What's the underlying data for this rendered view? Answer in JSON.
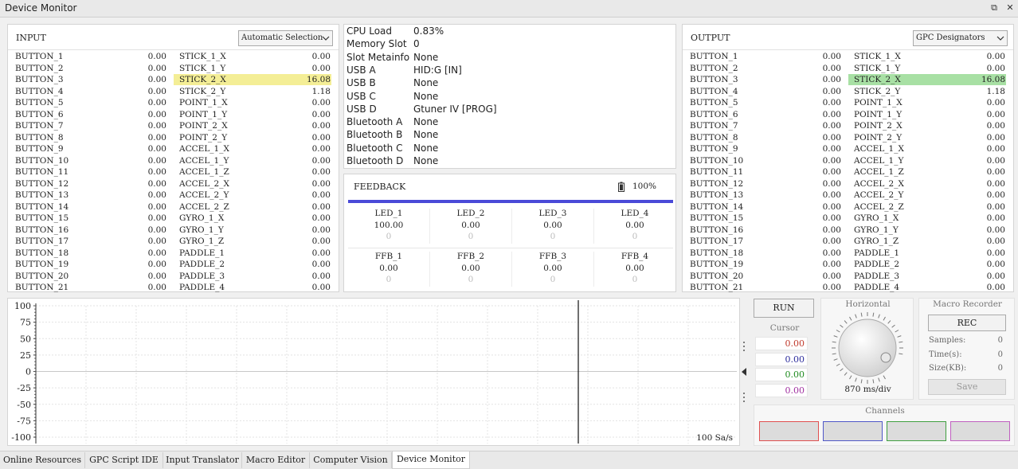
{
  "window": {
    "title": "Device Monitor"
  },
  "input": {
    "title": "INPUT",
    "selector": "Automatic Selection",
    "rows": [
      {
        "b": "BUTTON_1",
        "bv": "0.00",
        "a": "STICK_1_X",
        "av": "0.00"
      },
      {
        "b": "BUTTON_2",
        "bv": "0.00",
        "a": "STICK_1_Y",
        "av": "0.00"
      },
      {
        "b": "BUTTON_3",
        "bv": "0.00",
        "a": "STICK_2_X",
        "av": "16.08"
      },
      {
        "b": "BUTTON_4",
        "bv": "0.00",
        "a": "STICK_2_Y",
        "av": "1.18"
      },
      {
        "b": "BUTTON_5",
        "bv": "0.00",
        "a": "POINT_1_X",
        "av": "0.00"
      },
      {
        "b": "BUTTON_6",
        "bv": "0.00",
        "a": "POINT_1_Y",
        "av": "0.00"
      },
      {
        "b": "BUTTON_7",
        "bv": "0.00",
        "a": "POINT_2_X",
        "av": "0.00"
      },
      {
        "b": "BUTTON_8",
        "bv": "0.00",
        "a": "POINT_2_Y",
        "av": "0.00"
      },
      {
        "b": "BUTTON_9",
        "bv": "0.00",
        "a": "ACCEL_1_X",
        "av": "0.00"
      },
      {
        "b": "BUTTON_10",
        "bv": "0.00",
        "a": "ACCEL_1_Y",
        "av": "0.00"
      },
      {
        "b": "BUTTON_11",
        "bv": "0.00",
        "a": "ACCEL_1_Z",
        "av": "0.00"
      },
      {
        "b": "BUTTON_12",
        "bv": "0.00",
        "a": "ACCEL_2_X",
        "av": "0.00"
      },
      {
        "b": "BUTTON_13",
        "bv": "0.00",
        "a": "ACCEL_2_Y",
        "av": "0.00"
      },
      {
        "b": "BUTTON_14",
        "bv": "0.00",
        "a": "ACCEL_2_Z",
        "av": "0.00"
      },
      {
        "b": "BUTTON_15",
        "bv": "0.00",
        "a": "GYRO_1_X",
        "av": "0.00"
      },
      {
        "b": "BUTTON_16",
        "bv": "0.00",
        "a": "GYRO_1_Y",
        "av": "0.00"
      },
      {
        "b": "BUTTON_17",
        "bv": "0.00",
        "a": "GYRO_1_Z",
        "av": "0.00"
      },
      {
        "b": "BUTTON_18",
        "bv": "0.00",
        "a": "PADDLE_1",
        "av": "0.00"
      },
      {
        "b": "BUTTON_19",
        "bv": "0.00",
        "a": "PADDLE_2",
        "av": "0.00"
      },
      {
        "b": "BUTTON_20",
        "bv": "0.00",
        "a": "PADDLE_3",
        "av": "0.00"
      },
      {
        "b": "BUTTON_21",
        "bv": "0.00",
        "a": "PADDLE_4",
        "av": "0.00"
      }
    ],
    "highlight_row": 2,
    "highlight_color": "#f4ee96"
  },
  "output": {
    "title": "OUTPUT",
    "selector": "GPC Designators",
    "rows": [
      {
        "b": "BUTTON_1",
        "bv": "0.00",
        "a": "STICK_1_X",
        "av": "0.00"
      },
      {
        "b": "BUTTON_2",
        "bv": "0.00",
        "a": "STICK_1_Y",
        "av": "0.00"
      },
      {
        "b": "BUTTON_3",
        "bv": "0.00",
        "a": "STICK_2_X",
        "av": "16.08"
      },
      {
        "b": "BUTTON_4",
        "bv": "0.00",
        "a": "STICK_2_Y",
        "av": "1.18"
      },
      {
        "b": "BUTTON_5",
        "bv": "0.00",
        "a": "POINT_1_X",
        "av": "0.00"
      },
      {
        "b": "BUTTON_6",
        "bv": "0.00",
        "a": "POINT_1_Y",
        "av": "0.00"
      },
      {
        "b": "BUTTON_7",
        "bv": "0.00",
        "a": "POINT_2_X",
        "av": "0.00"
      },
      {
        "b": "BUTTON_8",
        "bv": "0.00",
        "a": "POINT_2_Y",
        "av": "0.00"
      },
      {
        "b": "BUTTON_9",
        "bv": "0.00",
        "a": "ACCEL_1_X",
        "av": "0.00"
      },
      {
        "b": "BUTTON_10",
        "bv": "0.00",
        "a": "ACCEL_1_Y",
        "av": "0.00"
      },
      {
        "b": "BUTTON_11",
        "bv": "0.00",
        "a": "ACCEL_1_Z",
        "av": "0.00"
      },
      {
        "b": "BUTTON_12",
        "bv": "0.00",
        "a": "ACCEL_2_X",
        "av": "0.00"
      },
      {
        "b": "BUTTON_13",
        "bv": "0.00",
        "a": "ACCEL_2_Y",
        "av": "0.00"
      },
      {
        "b": "BUTTON_14",
        "bv": "0.00",
        "a": "ACCEL_2_Z",
        "av": "0.00"
      },
      {
        "b": "BUTTON_15",
        "bv": "0.00",
        "a": "GYRO_1_X",
        "av": "0.00"
      },
      {
        "b": "BUTTON_16",
        "bv": "0.00",
        "a": "GYRO_1_Y",
        "av": "0.00"
      },
      {
        "b": "BUTTON_17",
        "bv": "0.00",
        "a": "GYRO_1_Z",
        "av": "0.00"
      },
      {
        "b": "BUTTON_18",
        "bv": "0.00",
        "a": "PADDLE_1",
        "av": "0.00"
      },
      {
        "b": "BUTTON_19",
        "bv": "0.00",
        "a": "PADDLE_2",
        "av": "0.00"
      },
      {
        "b": "BUTTON_20",
        "bv": "0.00",
        "a": "PADDLE_3",
        "av": "0.00"
      },
      {
        "b": "BUTTON_21",
        "bv": "0.00",
        "a": "PADDLE_4",
        "av": "0.00"
      }
    ],
    "highlight_row": 2,
    "highlight_color": "#a8e0a4"
  },
  "status": [
    {
      "k": "CPU Load",
      "v": "0.83%"
    },
    {
      "k": "Memory Slot",
      "v": "0"
    },
    {
      "k": "Slot Metainfo",
      "v": "None"
    },
    {
      "k": "USB A",
      "v": "HID:G [IN]"
    },
    {
      "k": "USB B",
      "v": "None"
    },
    {
      "k": "USB C",
      "v": "None"
    },
    {
      "k": "USB D",
      "v": "Gtuner IV [PROG]"
    },
    {
      "k": "Bluetooth A",
      "v": "None"
    },
    {
      "k": "Bluetooth B",
      "v": "None"
    },
    {
      "k": "Bluetooth C",
      "v": "None"
    },
    {
      "k": "Bluetooth D",
      "v": "None"
    }
  ],
  "feedback": {
    "title": "FEEDBACK",
    "battery": "100%",
    "bar_color": "#4a4ad8",
    "leds": [
      {
        "label": "LED_1",
        "value": "100.00",
        "raw": "0"
      },
      {
        "label": "LED_2",
        "value": "0.00",
        "raw": "0"
      },
      {
        "label": "LED_3",
        "value": "0.00",
        "raw": "0"
      },
      {
        "label": "LED_4",
        "value": "0.00",
        "raw": "0"
      }
    ],
    "ffb": [
      {
        "label": "FFB_1",
        "value": "0.00",
        "raw": "0"
      },
      {
        "label": "FFB_2",
        "value": "0.00",
        "raw": "0"
      },
      {
        "label": "FFB_3",
        "value": "0.00",
        "raw": "0"
      },
      {
        "label": "FFB_4",
        "value": "0.00",
        "raw": "0"
      }
    ]
  },
  "scope": {
    "y_ticks": [
      "100",
      "75",
      "50",
      "25",
      "0",
      "-25",
      "-50",
      "-75",
      "-100"
    ],
    "rate": "100 Sa/s"
  },
  "controls": {
    "run_label": "RUN",
    "cursor_label": "Cursor",
    "cursor_values": [
      {
        "v": "0.00",
        "color": "#c0392b"
      },
      {
        "v": "0.00",
        "color": "#2c2c9c"
      },
      {
        "v": "0.00",
        "color": "#1e8a1e"
      },
      {
        "v": "0.00",
        "color": "#a030a0"
      }
    ],
    "horizontal_label": "Horizontal",
    "horizontal_value": "870 ms/div",
    "macro": {
      "title": "Macro Recorder",
      "rec_label": "REC",
      "samples_label": "Samples:",
      "samples": "0",
      "time_label": "Time(s):",
      "time": "0",
      "size_label": "Size(KB):",
      "size": "0",
      "save_label": "Save"
    },
    "channels_label": "Channels",
    "channel_colors": [
      "#e05050",
      "#5058c8",
      "#40a040",
      "#c060c0"
    ]
  },
  "tabs": [
    "Online Resources",
    "GPC Script IDE",
    "Input Translator",
    "Macro Editor",
    "Computer Vision",
    "Device Monitor"
  ],
  "active_tab": "Device Monitor"
}
